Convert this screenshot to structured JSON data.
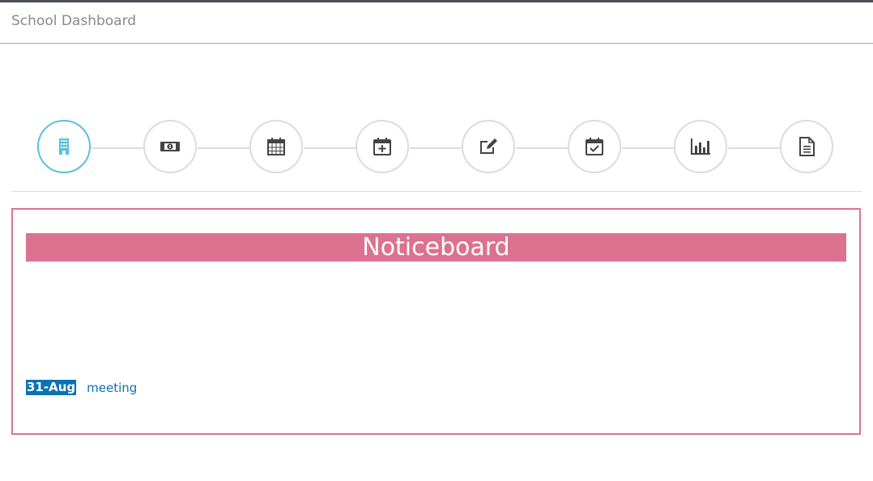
{
  "header": {
    "title": "School Dashboard"
  },
  "steps": [
    {
      "icon": "building-icon",
      "active": true
    },
    {
      "icon": "money-icon",
      "active": false
    },
    {
      "icon": "calendar-icon",
      "active": false
    },
    {
      "icon": "calendar-plus-icon",
      "active": false
    },
    {
      "icon": "edit-icon",
      "active": false
    },
    {
      "icon": "calendar-check-icon",
      "active": false
    },
    {
      "icon": "bar-chart-icon",
      "active": false
    },
    {
      "icon": "document-icon",
      "active": false
    }
  ],
  "colors": {
    "active_step": "#5bc0de",
    "noticeboard": "#dc7190",
    "link": "#0b72b5"
  },
  "noticeboard": {
    "title": "Noticeboard",
    "items": [
      {
        "date": "31-Aug",
        "text": "meeting"
      }
    ]
  }
}
